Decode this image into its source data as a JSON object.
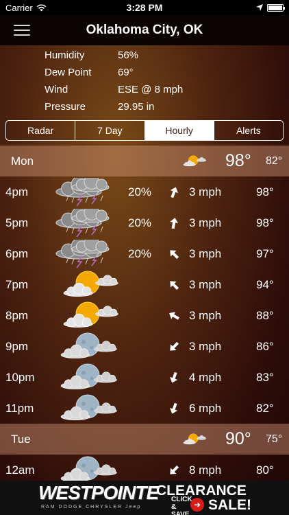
{
  "status_bar": {
    "carrier": "Carrier",
    "time": "3:28 PM"
  },
  "nav": {
    "title": "Oklahoma City, OK"
  },
  "details": [
    {
      "label": "Humidity",
      "value": "56%"
    },
    {
      "label": "Dew Point",
      "value": "69°"
    },
    {
      "label": "Wind",
      "value": "ESE @ 8 mph"
    },
    {
      "label": "Pressure",
      "value": "29.95 in"
    }
  ],
  "tabs": [
    "Radar",
    "7 Day",
    "Hourly",
    "Alerts"
  ],
  "active_tab": "Hourly",
  "days": [
    {
      "name": "Mon",
      "high": "98°",
      "low": "82°",
      "icon": "partly-cloudy-day-icon"
    },
    {
      "name": "Tue",
      "high": "90°",
      "low": "75°",
      "icon": "partly-cloudy-day-icon"
    }
  ],
  "hours": [
    {
      "time": "4pm",
      "pop": "20%",
      "wind": "3 mph",
      "temp": "98°",
      "icon": "thunderstorm-icon",
      "wind_dir_deg": 20
    },
    {
      "time": "5pm",
      "pop": "20%",
      "wind": "3 mph",
      "temp": "98°",
      "icon": "thunderstorm-icon",
      "wind_dir_deg": 10
    },
    {
      "time": "6pm",
      "pop": "20%",
      "wind": "3 mph",
      "temp": "97°",
      "icon": "thunderstorm-icon",
      "wind_dir_deg": -45
    },
    {
      "time": "7pm",
      "pop": "",
      "wind": "3 mph",
      "temp": "94°",
      "icon": "partly-cloudy-day-icon",
      "wind_dir_deg": -45
    },
    {
      "time": "8pm",
      "pop": "",
      "wind": "3 mph",
      "temp": "88°",
      "icon": "partly-cloudy-day-icon",
      "wind_dir_deg": -60
    },
    {
      "time": "9pm",
      "pop": "",
      "wind": "3 mph",
      "temp": "86°",
      "icon": "partly-cloudy-night-icon",
      "wind_dir_deg": 225
    },
    {
      "time": "10pm",
      "pop": "",
      "wind": "4 mph",
      "temp": "83°",
      "icon": "partly-cloudy-night-icon",
      "wind_dir_deg": 200
    },
    {
      "time": "11pm",
      "pop": "",
      "wind": "6 mph",
      "temp": "82°",
      "icon": "partly-cloudy-night-icon",
      "wind_dir_deg": 200
    },
    {
      "time": "12am",
      "pop": "",
      "wind": "8 mph",
      "temp": "80°",
      "icon": "partly-cloudy-night-icon",
      "wind_dir_deg": 225
    }
  ],
  "ad": {
    "brand": "WESTPOINTE",
    "makes": "RAM  DODGE  CHRYSLER  Jeep",
    "headline": "CLEARANCE",
    "cta": "CLICK & SAVE",
    "tail": "SALE!"
  },
  "colors": {
    "day_row_bg": "#c8907a",
    "sun": "#f5a800",
    "moon": "#9fb4c4",
    "ad_button": "#d61b1b"
  }
}
